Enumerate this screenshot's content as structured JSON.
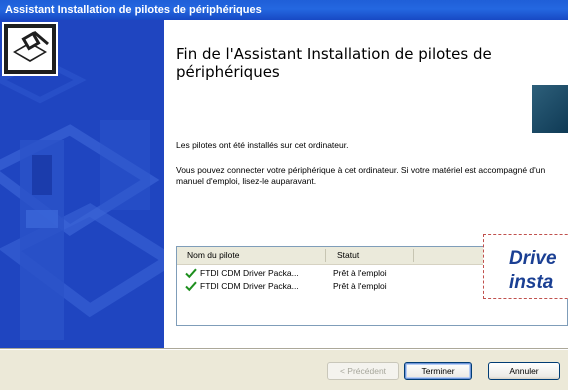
{
  "window": {
    "title": "Assistant Installation de pilotes de périphériques"
  },
  "content": {
    "heading": "Fin de l'Assistant Installation de pilotes de périphériques",
    "paragraph1": "Les pilotes ont été installés sur cet ordinateur.",
    "paragraph2": "Vous pouvez connecter votre périphérique à cet ordinateur. Si votre matériel est accompagné d'un manuel d'emploi, lisez-le auparavant."
  },
  "driver_list": {
    "columns": [
      "Nom du pilote",
      "Statut"
    ],
    "rows": [
      {
        "name": "FTDI CDM Driver Packa...",
        "status": "Prêt à l'emploi",
        "icon": "check-icon"
      },
      {
        "name": "FTDI CDM Driver Packa...",
        "status": "Prêt à l'emploi",
        "icon": "check-icon"
      }
    ]
  },
  "callout": {
    "line1": "Drive",
    "line2": "insta"
  },
  "buttons": {
    "back": "< Précédent",
    "finish": "Terminer",
    "cancel": "Annuler"
  },
  "colors": {
    "titlebar": "#1f5fd8",
    "side_panel": "#1f45c0",
    "callout_border": "#c0504d",
    "callout_text": "#1a3f93",
    "check": "#1e8f1e"
  }
}
